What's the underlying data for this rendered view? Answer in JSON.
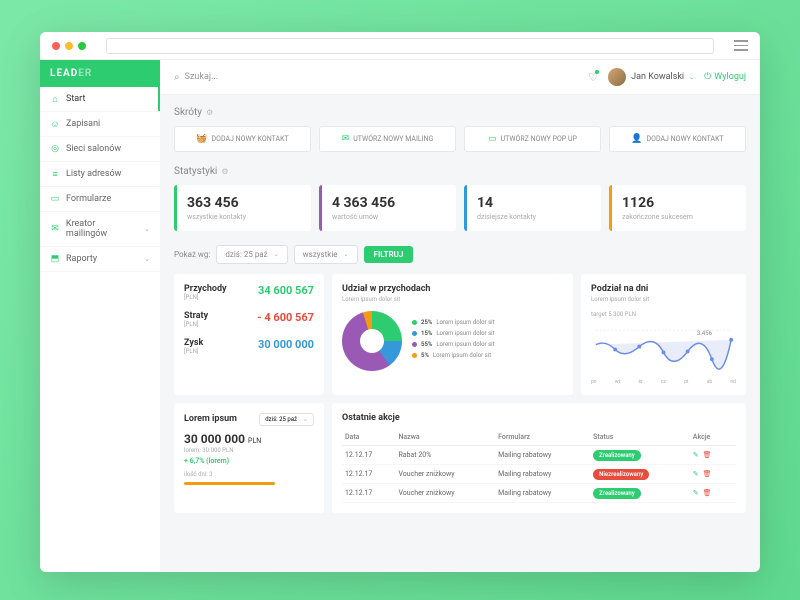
{
  "logo": {
    "part1": "LEAD",
    "part2": "ER"
  },
  "search": {
    "placeholder": "Szukaj..."
  },
  "user": {
    "name": "Jan Kowalski"
  },
  "logout": "Wyloguj",
  "sidebar": {
    "items": [
      {
        "label": "Start"
      },
      {
        "label": "Zapisani"
      },
      {
        "label": "Sieci salonów"
      },
      {
        "label": "Listy adresów"
      },
      {
        "label": "Formularze"
      },
      {
        "label": "Kreator mailingów"
      },
      {
        "label": "Raporty"
      }
    ]
  },
  "shortcuts": {
    "title": "Skróty",
    "items": [
      {
        "label": "DODAJ NOWY KONTAKT"
      },
      {
        "label": "UTWÓRZ NOWY MAILING"
      },
      {
        "label": "UTWÓRZ NOWY POP UP"
      },
      {
        "label": "DODAJ NOWY KONTAKT"
      }
    ]
  },
  "stats": {
    "title": "Statystyki",
    "items": [
      {
        "value": "363 456",
        "label": "wszystkie kontakty"
      },
      {
        "value": "4 363 456",
        "label": "wartość umów"
      },
      {
        "value": "14",
        "label": "dzisiejsze kontakty"
      },
      {
        "value": "1126",
        "label": "zakończone sukcesem"
      }
    ]
  },
  "filters": {
    "label": "Pokaż wg:",
    "date": "dziś: 25 paź",
    "all": "wszystkie",
    "button": "FILTRUJ"
  },
  "finance": {
    "currency": "[PLN]",
    "rows": [
      {
        "label": "Przychody",
        "value": "34 600 567",
        "cls": "green"
      },
      {
        "label": "Straty",
        "value": "- 4 600 567",
        "cls": "red"
      },
      {
        "label": "Zysk",
        "value": "30 000 000",
        "cls": "blue"
      }
    ]
  },
  "pie": {
    "title": "Udział w przychodach",
    "sub": "Lorem ipsum dolor sit",
    "legend": [
      {
        "pct": "25%",
        "text": "Lorem ipsum dolor sit",
        "color": "#2ecc71"
      },
      {
        "pct": "15%",
        "text": "Lorem ipsum dolor sit",
        "color": "#3498db"
      },
      {
        "pct": "55%",
        "text": "Lorem ipsum dolor sit",
        "color": "#9b59b6"
      },
      {
        "pct": "5%",
        "text": "Lorem ipsum dolor sit",
        "color": "#f39c12"
      }
    ]
  },
  "days": {
    "title": "Podział na dni",
    "sub": "Lorem ipsum dolor sit",
    "target": "target 5 300 PLN",
    "datapoint": "3.456",
    "xaxis": [
      "pn",
      "wt",
      "śr",
      "cz",
      "pt",
      "sb",
      "nd"
    ]
  },
  "lorem": {
    "title": "Lorem ipsum",
    "date": "dziś: 25 paź",
    "value": "30 000 000",
    "unit": "PLN",
    "sub": "lorem: 30.000 PLN",
    "delta": "+ 6,7% (lorem)",
    "days_label": "ilość dni: 3"
  },
  "actions": {
    "title": "Ostatnie akcje",
    "headers": [
      "Data",
      "Nazwa",
      "Formularz",
      "Status",
      "Akcje"
    ],
    "rows": [
      {
        "date": "12.12.17",
        "name": "Rabat 20%",
        "form": "Mailing rabatowy",
        "status": "Zrealizowany",
        "ok": true
      },
      {
        "date": "12.12.17",
        "name": "Voucher zniżkowy",
        "form": "Mailing rabatowy",
        "status": "Niezrealizowany",
        "ok": false
      },
      {
        "date": "12.12.17",
        "name": "Voucher zniżkowy",
        "form": "Mailing rabatowy",
        "status": "Zrealizowany",
        "ok": true
      }
    ]
  },
  "chart_data": {
    "type": "line",
    "title": "Podział na dni",
    "categories": [
      "pn",
      "wt",
      "śr",
      "cz",
      "pt",
      "sb",
      "nd"
    ],
    "values": [
      3900,
      3200,
      4100,
      3400,
      3456,
      2900,
      4300
    ],
    "target": 5300,
    "ylabel": "PLN"
  }
}
